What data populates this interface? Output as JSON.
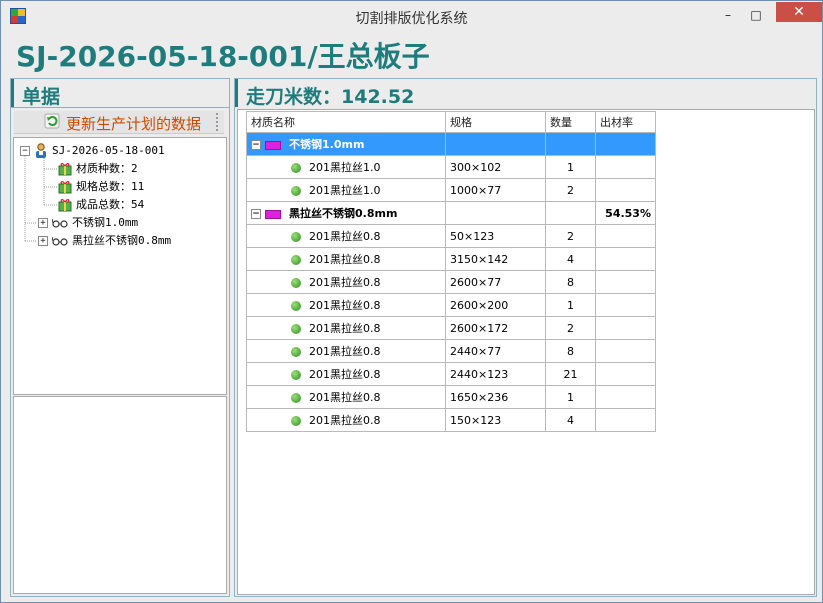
{
  "window": {
    "title": "切割排版优化系统",
    "minimize_glyph": "–",
    "maximize_glyph": "□",
    "close_glyph": "✕"
  },
  "document_title": "SJ-2026-05-18-001/王总板子",
  "left_panel": {
    "header": "单据",
    "refresh_button": "更新生产计划的数据",
    "tree": {
      "root": "SJ-2026-05-18-001",
      "stats": [
        "材质种数：2",
        "规格总数：11",
        "成品总数：54"
      ],
      "materials": [
        "不锈钢1.0mm",
        "黑拉丝不锈钢0.8mm"
      ]
    }
  },
  "right_panel": {
    "header": "走刀米数：142.52",
    "columns": [
      "材质名称",
      "规格",
      "数量",
      "出材率"
    ],
    "groups": [
      {
        "name": "不锈钢1.0mm",
        "rate": "",
        "rows": [
          {
            "name": "201黑拉丝1.0",
            "spec": "300×102",
            "qty": "1"
          },
          {
            "name": "201黑拉丝1.0",
            "spec": "1000×77",
            "qty": "2"
          }
        ]
      },
      {
        "name": "黑拉丝不锈钢0.8mm",
        "rate": "54.53%",
        "rows": [
          {
            "name": "201黑拉丝0.8",
            "spec": "50×123",
            "qty": "2"
          },
          {
            "name": "201黑拉丝0.8",
            "spec": "3150×142",
            "qty": "4"
          },
          {
            "name": "201黑拉丝0.8",
            "spec": "2600×77",
            "qty": "8"
          },
          {
            "name": "201黑拉丝0.8",
            "spec": "2600×200",
            "qty": "1"
          },
          {
            "name": "201黑拉丝0.8",
            "spec": "2600×172",
            "qty": "2"
          },
          {
            "name": "201黑拉丝0.8",
            "spec": "2440×77",
            "qty": "8"
          },
          {
            "name": "201黑拉丝0.8",
            "spec": "2440×123",
            "qty": "21"
          },
          {
            "name": "201黑拉丝0.8",
            "spec": "1650×236",
            "qty": "1"
          },
          {
            "name": "201黑拉丝0.8",
            "spec": "150×123",
            "qty": "4"
          }
        ]
      }
    ]
  },
  "colors": {
    "accent": "#1f7c7d",
    "selection": "#3399ff",
    "material_swatch": "#e020e0",
    "refresh_label": "#cc4b00"
  }
}
